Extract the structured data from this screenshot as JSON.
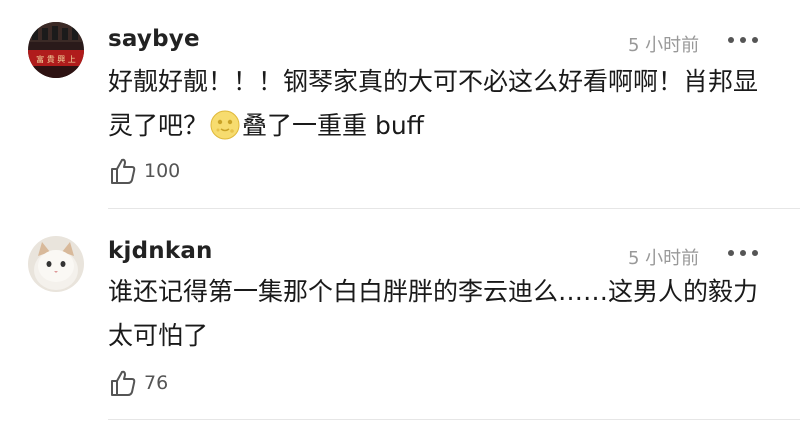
{
  "comments": [
    {
      "username": "saybye",
      "time": "5 小时前",
      "text_before_emoji": "好靓好靓！！！钢琴家真的大可不必这么好看啊啊！肖邦显灵了吧？",
      "emoji": "moon-face-emoji",
      "text_after_emoji": "叠了一重重 buff",
      "likes": "100",
      "avatar_sign_text": "富 貴 興 上"
    },
    {
      "username": "kjdnkan",
      "time": "5 小时前",
      "text": "谁还记得第一集那个白白胖胖的李云迪么……这男人的毅力太可怕了",
      "likes": "76"
    }
  ],
  "colors": {
    "username": "#222222",
    "time": "#999999",
    "body_text": "#1a1a1a",
    "divider": "#e6e6e6",
    "icon": "#555555"
  }
}
